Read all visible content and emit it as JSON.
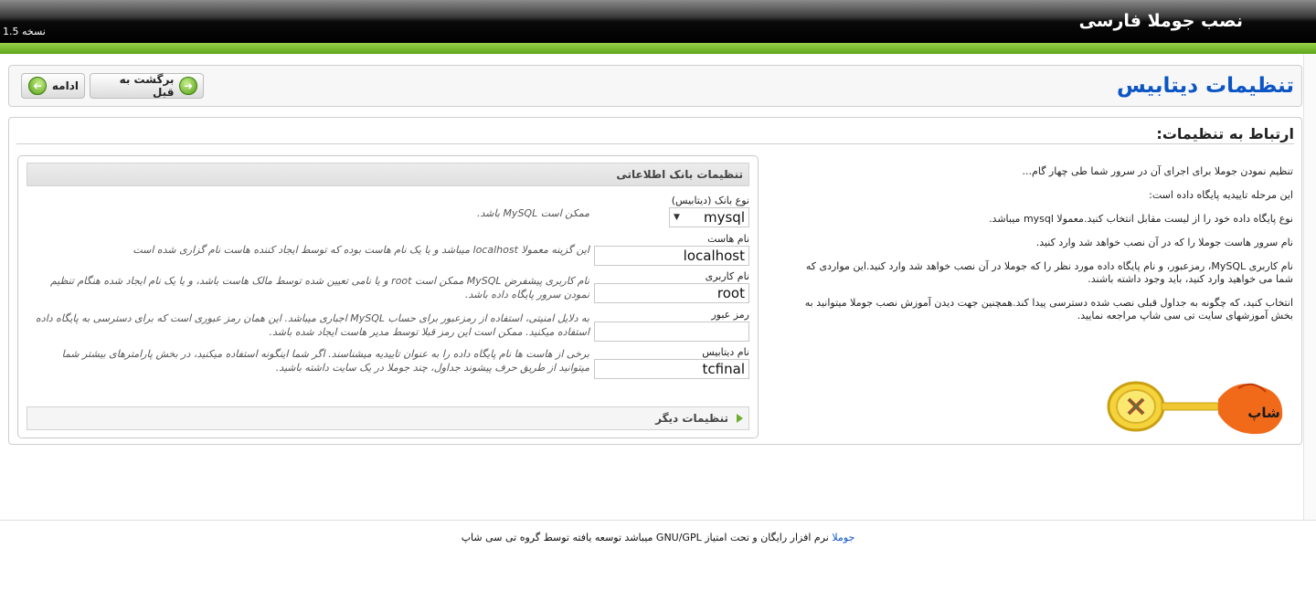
{
  "app": {
    "title": "نصب جوملا فارسی",
    "version": "نسخه 1.5"
  },
  "header": {
    "heading": "تنظیمات دیتابیس",
    "back_label": "برگشت به قبل",
    "next_label": "ادامه"
  },
  "main": {
    "subheading": "ارتباط به تنظیمات:",
    "info": [
      "تنظیم نمودن جوملا برای اجرای آن در سرور شما طی چهار گام...",
      "این مرحله تاییدیه پایگاه داده است:",
      "نوع پایگاه داده خود را از لیست مقابل انتخاب کنید.معمولا mysql میباشد.",
      "نام سرور هاست جوملا را که در آن نصب خواهد شد وارد کنید.",
      "نام کاربری MySQL، رمزعبور، و نام پایگاه داده مورد نظر را که جوملا در آن نصب خواهد شد وارد کنید.این مواردی که شما می خواهید وارد کنید، باید وجود داشته باشند.",
      "انتخاب کنید، که چگونه به جداول قبلی نصب شده دسترسی پیدا کند.همچنین جهت دیدن آموزش نصب جوملا میتوانید به بخش آموزشهای سایت تی سی شاپ مراجعه نمایید."
    ],
    "logo_text": "شاپ"
  },
  "db": {
    "section_title": "تنظیمات بانک اطلاعاتی",
    "type": {
      "label": "نوع بانک (دیتابیس)",
      "value": "mysql",
      "hint": "ممکن است MySQL باشد."
    },
    "host": {
      "label": "نام هاست",
      "value": "localhost",
      "hint": "این گزینه معمولا localhost میباشد و یا یک نام هاست بوده که توسط ایجاد کننده هاست نام گزاری شده است"
    },
    "user": {
      "label": "نام کاربری",
      "value": "root",
      "hint": "نام کاربری پیشفرض MySQL ممکن است root و یا نامی تعیین شده توسط مالک هاست باشد، و یا یک نام ایجاد شده هنگام تنظیم نمودن سرور پایگاه داده باشد."
    },
    "password": {
      "label": "رمز عبور",
      "value": "",
      "hint": "به دلایل امنیتی، استفاده از رمزعبور برای حساب MySQL اجباری میباشد. این همان رمز عبوری است که برای دسترسی به پایگاه داده استفاده میکنید. ممکن است این رمز قبلا توسط مدیر هاست ایجاد شده باشد."
    },
    "name": {
      "label": "نام دیتابیس",
      "value": "tcfinal",
      "hint": "برخی از هاست ها نام پایگاه داده را به عنوان تاییدیه میشناسند. اگر شما اینگونه استفاده میکنید، در بخش پارامترهای بیشتر شما میتوانید از طریق حرف پیشوند جداول، چند جوملا در یک سایت داشته باشید."
    },
    "other_settings": "تنظیمات دیگر"
  },
  "footer": {
    "link": "جوملا",
    "text": " نرم افزار رایگان و تحت امتیاز GNU/GPL میباشد توسعه یافته توسط گروه تی سی شاپ"
  }
}
